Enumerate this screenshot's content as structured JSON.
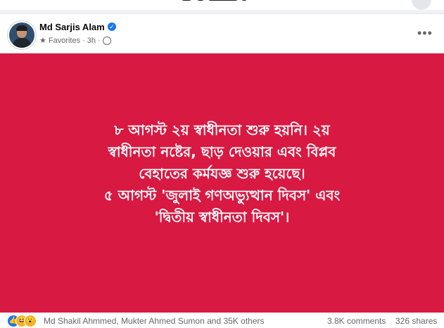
{
  "post": {
    "author": "Md Sarjis Alam",
    "meta": {
      "audience": "Favorites",
      "separator1": "·",
      "time": "3h",
      "separator2": "·"
    },
    "more_label": "•••",
    "text": "৮ আগস্ট ২য় স্বাধীনতা শুরু হয়নি। ২য়\nস্বাধীনতা নষ্টের, ছাড় দেওয়ার এবং বিপ্লব\nবেহাতের কর্মযজ্ঞ শুরু হয়েছে।\n৫ আগস্ট 'জুলাই গণঅভ্যুত্থান দিবস' এবং\n'দ্বিতীয় স্বাধীনতা দিবস'।",
    "background_color": "#d81942",
    "reactions": {
      "icons": [
        "like-icon",
        "haha-icon",
        "wow-icon"
      ],
      "names": "Md Shakil Ahmmed, Mukter Ahmed Sumon and 35K others",
      "comments": "3.8K comments",
      "shares": "326 shares"
    }
  },
  "colors": {
    "accent": "#1877f2",
    "secondary_text": "#65676b"
  }
}
